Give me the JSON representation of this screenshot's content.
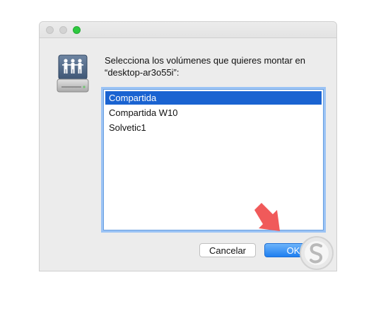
{
  "dialog": {
    "prompt_line1": "Selecciona los volúmenes que quieres montar en",
    "prompt_line2": "“desktop-ar3o55i”:"
  },
  "volumes": [
    {
      "label": "Compartida",
      "selected": true
    },
    {
      "label": "Compartida W10",
      "selected": false
    },
    {
      "label": "Solvetic1",
      "selected": false
    }
  ],
  "buttons": {
    "cancel_label": "Cancelar",
    "ok_label": "OK"
  },
  "icons": {
    "server": "shared-server-icon",
    "annotation_arrow": "red-arrow-icon",
    "watermark": "solvetic-logo"
  },
  "colors": {
    "selection": "#1a63d1",
    "ok_button": "#1f7ff0",
    "arrow": "#f05a5a"
  }
}
